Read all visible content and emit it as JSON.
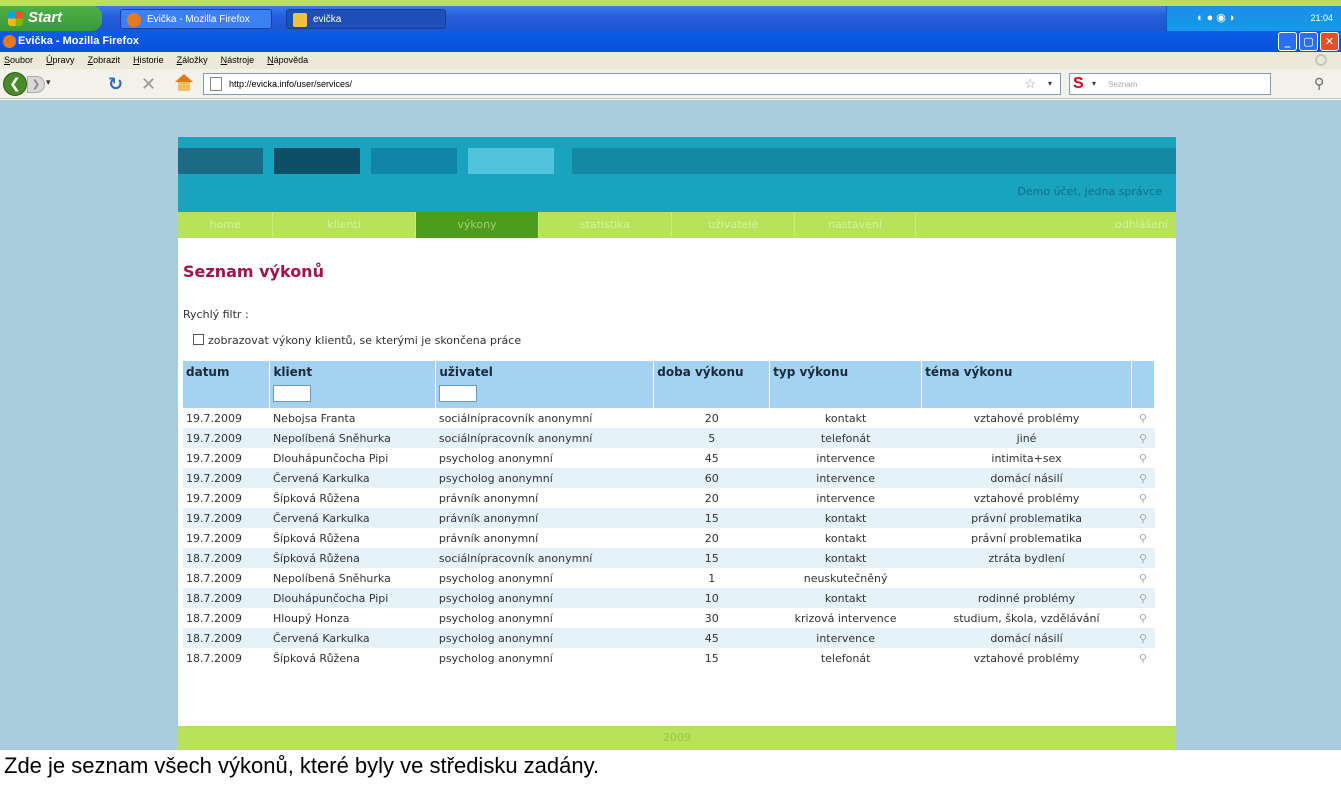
{
  "taskbar": {
    "start": "Start",
    "tasks": [
      "Evička - Mozilla Firefox",
      "evička"
    ],
    "clock": "21:04"
  },
  "window": {
    "title": "Evička - Mozilla Firefox"
  },
  "menu": [
    "Soubor",
    "Úpravy",
    "Zobrazit",
    "Historie",
    "Záložky",
    "Nástroje",
    "Nápověda"
  ],
  "address": {
    "url": "http://evicka.info/user/services/"
  },
  "search": {
    "placeholder": "Seznam"
  },
  "header": {
    "account": "Demo účet, jedna správce"
  },
  "nav": {
    "items": [
      "home",
      "klienti",
      "výkony",
      "statistika",
      "uživatelé",
      "nastavení"
    ],
    "active": "výkony",
    "logout": "odhlášení"
  },
  "main": {
    "title": "Seznam výkonů",
    "quick_filter": "Rychlý filtr :",
    "checkbox_label": "zobrazovat výkony klientů, se kterými je skončena práce"
  },
  "table": {
    "columns": [
      "datum",
      "klient",
      "uživatel",
      "doba výkonu",
      "typ výkonu",
      "téma výkonu"
    ],
    "rows": [
      [
        "19.7.2009",
        "Nebojsa Franta",
        "sociálnípracovník anonymní",
        "20",
        "kontakt",
        "vztahové problémy"
      ],
      [
        "19.7.2009",
        "Nepolíbená Sněhurka",
        "sociálnípracovník anonymní",
        "5",
        "telefonát",
        "jiné"
      ],
      [
        "19.7.2009",
        "Dlouhápunčocha Pipi",
        "psycholog anonymní",
        "45",
        "intervence",
        "intimita+sex"
      ],
      [
        "19.7.2009",
        "Červená Karkulka",
        "psycholog anonymní",
        "60",
        "intervence",
        "domácí násilí"
      ],
      [
        "19.7.2009",
        "Šípková Růžena",
        "právník anonymní",
        "20",
        "intervence",
        "vztahové problémy"
      ],
      [
        "19.7.2009",
        "Červená Karkulka",
        "právník anonymní",
        "15",
        "kontakt",
        "právní problematika"
      ],
      [
        "19.7.2009",
        "Šípková Růžena",
        "právník anonymní",
        "20",
        "kontakt",
        "právní problematika"
      ],
      [
        "18.7.2009",
        "Šípková Růžena",
        "sociálnípracovník anonymní",
        "15",
        "kontakt",
        "ztráta bydlení"
      ],
      [
        "18.7.2009",
        "Nepolíbená Sněhurka",
        "psycholog anonymní",
        "1",
        "neuskutečněný",
        ""
      ],
      [
        "18.7.2009",
        "Dlouhápunčocha Pipi",
        "psycholog anonymní",
        "10",
        "kontakt",
        "rodinné problémy"
      ],
      [
        "18.7.2009",
        "Hloupý Honza",
        "psycholog anonymní",
        "30",
        "krizová intervence",
        "studium, škola, vzdělávání"
      ],
      [
        "18.7.2009",
        "Červená Karkulka",
        "psycholog anonymní",
        "45",
        "intervence",
        "domácí násilí"
      ],
      [
        "18.7.2009",
        "Šípková Růžena",
        "psycholog anonymní",
        "15",
        "telefonát",
        "vztahové problémy"
      ]
    ]
  },
  "footer": {
    "text": "2009"
  },
  "caption": "Zde je seznam všech výkonů, které byly ve středisku zadány.",
  "colors": {
    "accent_green": "#b6e35a",
    "active_green": "#4c9d1c",
    "header_teal": "#1aa3bd",
    "title": "#a3124b",
    "table_header": "#a3d3f1"
  }
}
